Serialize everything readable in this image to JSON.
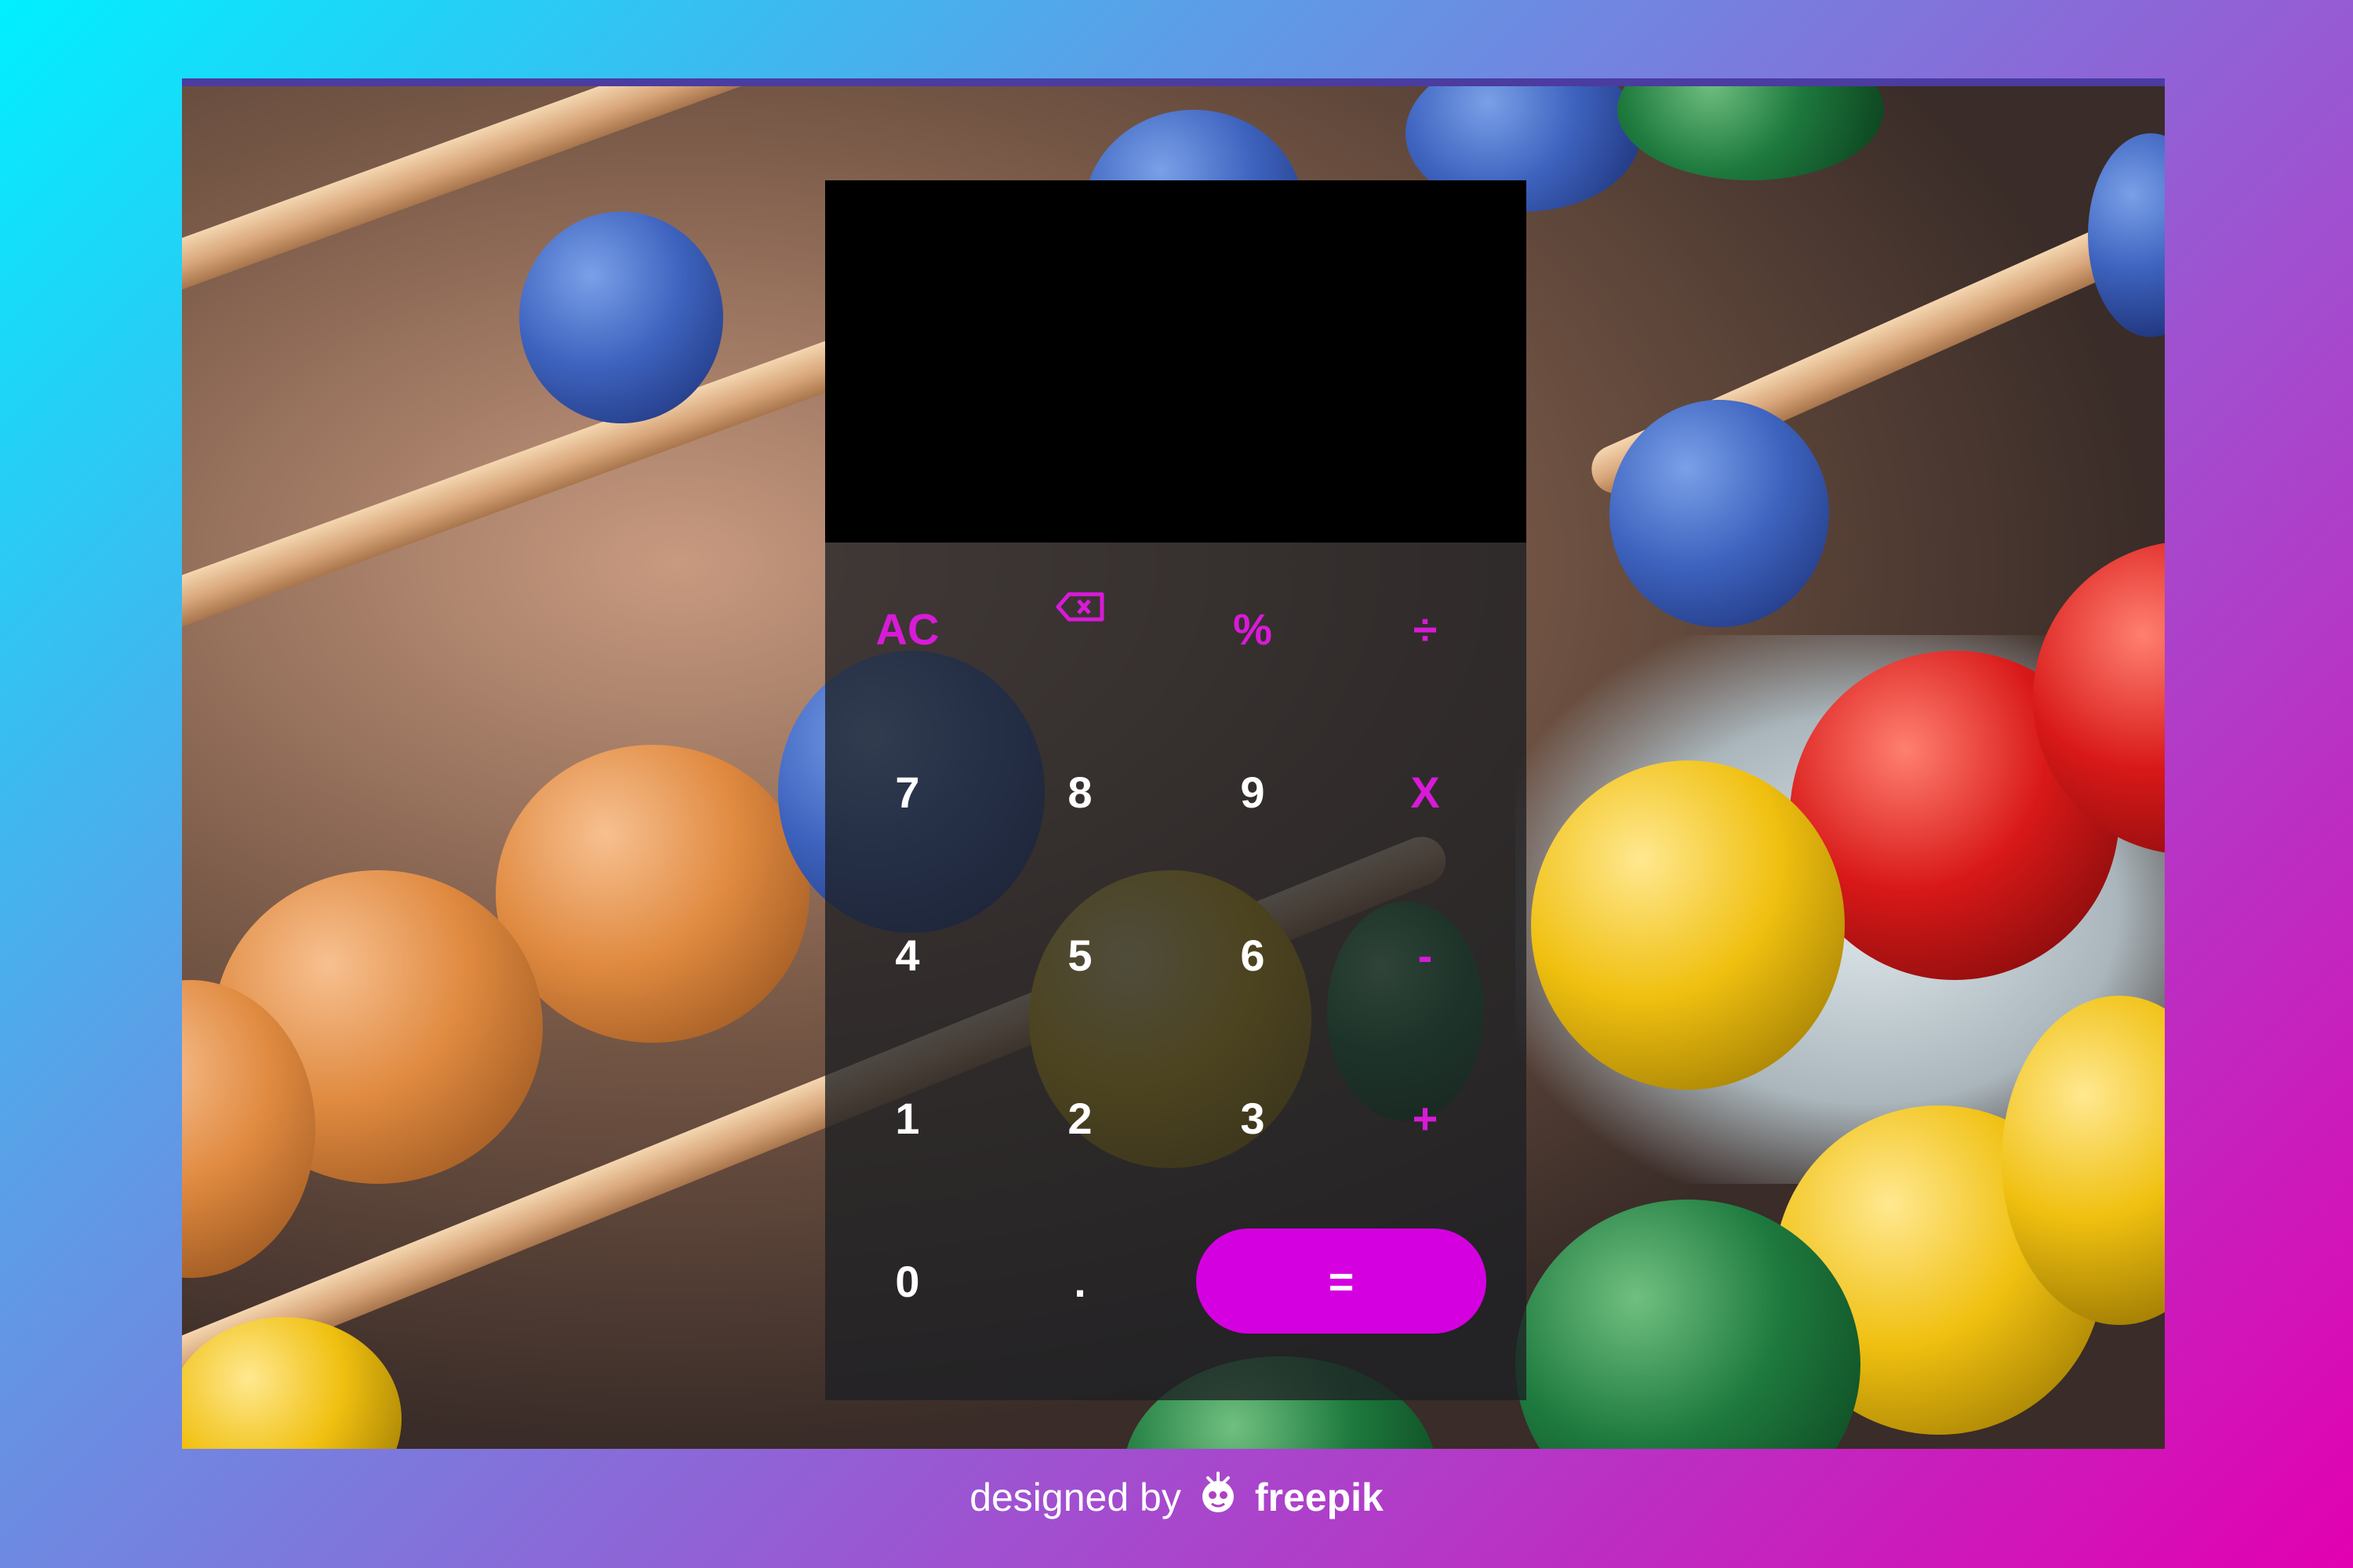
{
  "calculator": {
    "display_value": "",
    "keys": {
      "clear": "AC",
      "backspace_icon": "backspace-icon",
      "percent": "%",
      "divide": "÷",
      "seven": "7",
      "eight": "8",
      "nine": "9",
      "multiply": "X",
      "four": "4",
      "five": "5",
      "six": "6",
      "subtract": "-",
      "one": "1",
      "two": "2",
      "three": "3",
      "add": "+",
      "zero": "0",
      "decimal": ".",
      "equals": "="
    },
    "colors": {
      "operator": "#d81ad8",
      "equals_bg": "#d400e0",
      "digit": "#ffffff",
      "display_bg": "#000000"
    }
  },
  "background": {
    "gradient": [
      "#00f0ff",
      "#e200b0"
    ],
    "photo_icon": "abacus-photo"
  },
  "credit": {
    "prefix": "designed by",
    "icon": "freepik-logo-icon",
    "brand": "freepik"
  }
}
